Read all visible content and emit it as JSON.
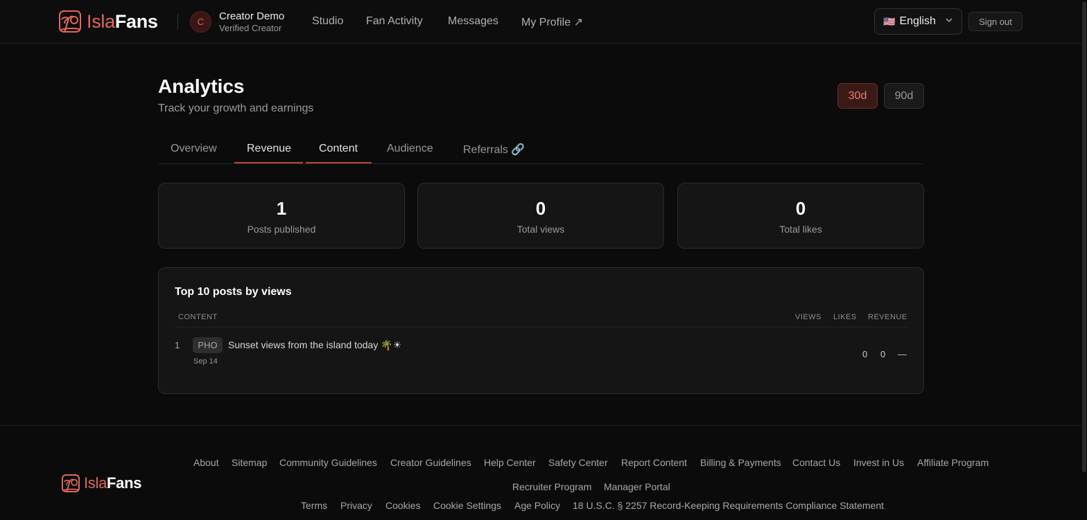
{
  "header": {
    "logo": {
      "part1": "Isla",
      "part2": "Fans",
      "icon": "palm-sunset-logo-icon"
    },
    "user": {
      "initial": "C",
      "name": "Creator Demo",
      "role": "Verified Creator"
    },
    "nav": [
      {
        "label": "Studio"
      },
      {
        "label": "Fan Activity"
      },
      {
        "label": "Messages"
      },
      {
        "label": "My Profile ↗"
      }
    ],
    "language": {
      "flag": "🇺🇸",
      "label": "English",
      "icon": "chevron-down-icon"
    },
    "signout_label": "Sign out"
  },
  "page": {
    "title": "Analytics",
    "subtitle": "Track your growth and earnings",
    "range": {
      "options": [
        "30d",
        "90d"
      ],
      "selected": "30d"
    },
    "tabs": [
      "Overview",
      "Revenue",
      "Content",
      "Audience",
      "Referrals 🔗"
    ],
    "active_tab": "Content"
  },
  "stats": [
    {
      "value": "1",
      "label": "Posts published"
    },
    {
      "value": "0",
      "label": "Total views"
    },
    {
      "value": "0",
      "label": "Total likes"
    }
  ],
  "top_posts": {
    "title": "Top 10 posts by views",
    "columns": [
      "CONTENT",
      "VIEWS",
      "LIKES",
      "REVENUE"
    ],
    "rows": [
      {
        "rank": "1",
        "type": "PHO",
        "title": "Sunset views from the island today 🌴☀",
        "date": "Sep 14",
        "views": "0",
        "likes": "0",
        "revenue": "—"
      }
    ]
  },
  "footer": {
    "links_row1": [
      "About",
      "Sitemap",
      "Community Guidelines",
      "Creator Guidelines",
      "Help Center",
      "Safety Center",
      "Report Content",
      "Billing & Payments",
      "Contact Us",
      "Invest in Us",
      "Affiliate Program"
    ],
    "links_row2": [
      "Recruiter Program",
      "Manager Portal"
    ],
    "links_row3": [
      "Terms",
      "Privacy",
      "Cookies",
      "Cookie Settings",
      "Age Policy",
      "18 U.S.C. § 2257 Record-Keeping Requirements Compliance Statement"
    ]
  },
  "colors": {
    "accent": "#e0685a",
    "background": "#0b0b0b",
    "card": "#151515"
  }
}
